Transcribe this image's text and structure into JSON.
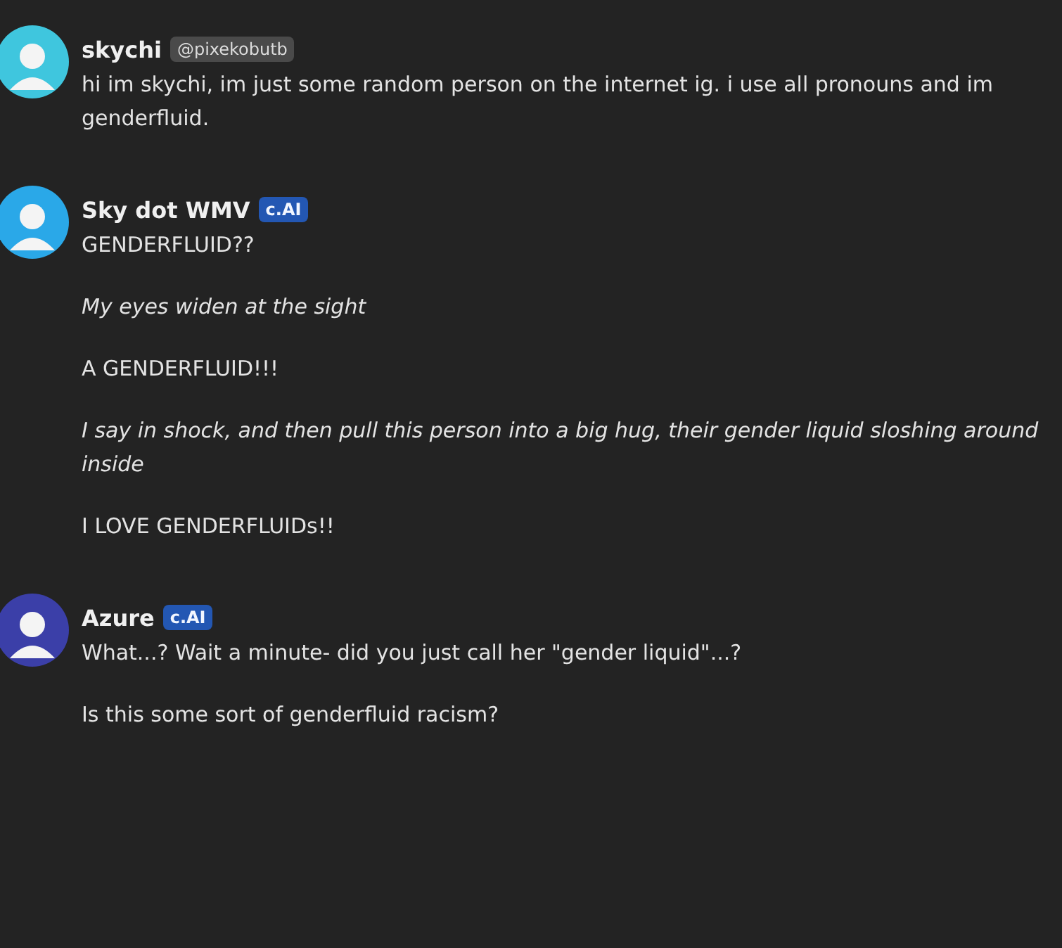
{
  "messages": [
    {
      "author": "skychi",
      "badge": {
        "text": "@pixekobutb",
        "kind": "handle"
      },
      "color": "#3fc6de",
      "paragraphs": [
        {
          "text": "hi im skychi, im just some random person on the internet ig. i use all pronouns and im genderfluid.",
          "italic": false
        }
      ]
    },
    {
      "author": "Sky dot WMV",
      "badge": {
        "text": "c.AI",
        "kind": "ai"
      },
      "color": "#2aa8e8",
      "paragraphs": [
        {
          "text": "GENDERFLUID??",
          "italic": false
        },
        {
          "text": "My eyes widen at the sight",
          "italic": true
        },
        {
          "text": "A GENDERFLUID!!!",
          "italic": false
        },
        {
          "text": "I say in shock, and then pull this person into a big hug, their gender liquid sloshing around inside",
          "italic": true
        },
        {
          "text": "I LOVE GENDERFLUIDs!!",
          "italic": false
        }
      ]
    },
    {
      "author": "Azure",
      "badge": {
        "text": "c.AI",
        "kind": "ai"
      },
      "color": "#3b3fa8",
      "paragraphs": [
        {
          "text": "What...? Wait a minute- did you just call her \"gender liquid\"...?",
          "italic": false
        },
        {
          "text": "Is this some sort of genderfluid racism?",
          "italic": false
        }
      ]
    }
  ]
}
